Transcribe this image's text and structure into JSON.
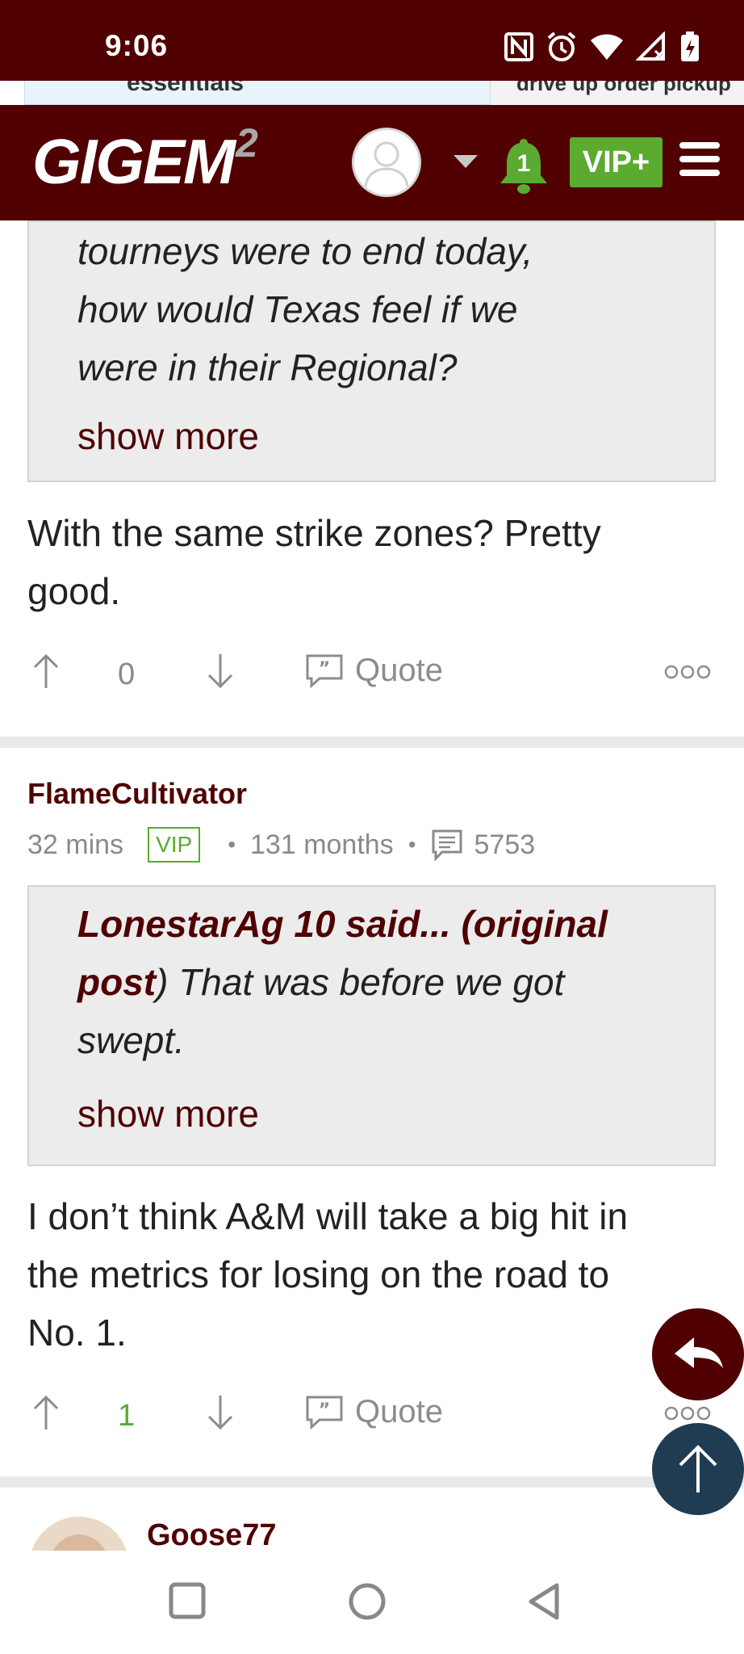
{
  "status_bar": {
    "time": "9:06"
  },
  "ad": {
    "left_text": "essentials",
    "right_text": "drive up order pickup"
  },
  "header": {
    "logo_text": "GIGEM",
    "logo_sup": "2",
    "notification_count": "1",
    "vip_label": "VIP+"
  },
  "posts": [
    {
      "quote": {
        "lines": [
          "tourneys were to end today,",
          "how would Texas feel if we",
          "were in their Regional?"
        ],
        "show_more": "show more"
      },
      "body_lines": [
        "With the same strike zones? Pretty",
        "good."
      ],
      "votes": "0",
      "quote_label": "Quote"
    },
    {
      "author": "FlameCultivator",
      "time": "32 mins",
      "badge": "VIP",
      "tenure": "131 months",
      "post_count": "5753",
      "quote": {
        "author_part1": "LonestarAg 10 said... (original",
        "author_part2": "post",
        "text_part1": ") That was before we got",
        "text_line3": "swept.",
        "show_more": "show more"
      },
      "body_lines": [
        "I don’t think A&M will take a big hit in",
        "the metrics for losing on the road to",
        "No. 1."
      ],
      "votes": "1",
      "quote_label": "Quote"
    },
    {
      "author": "Goose77"
    }
  ],
  "colors": {
    "maroon": "#500000",
    "vip_green": "#5aab2f",
    "fab_blue": "#1f3c53"
  }
}
